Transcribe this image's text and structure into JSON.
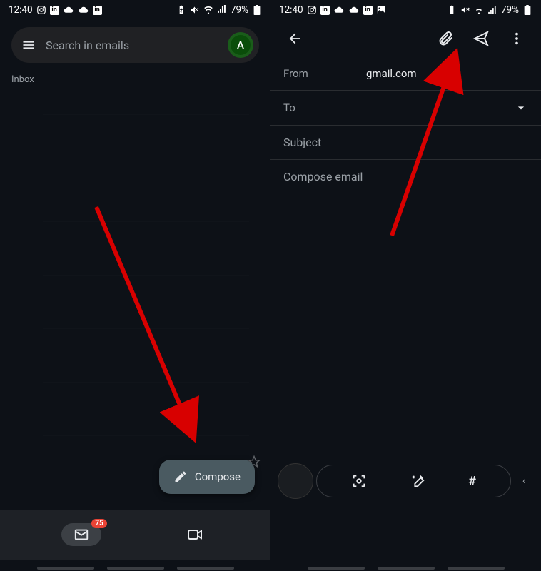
{
  "status": {
    "time": "12:40",
    "battery": "79%"
  },
  "left": {
    "search_placeholder": "Search in emails",
    "avatar_letter": "A",
    "inbox_label": "Inbox",
    "compose_label": "Compose",
    "badge_count": "75"
  },
  "right": {
    "from_label": "From",
    "from_value": "gmail.com",
    "to_label": "To",
    "subject_label": "Subject",
    "body_placeholder": "Compose email",
    "hash_label": "#"
  }
}
